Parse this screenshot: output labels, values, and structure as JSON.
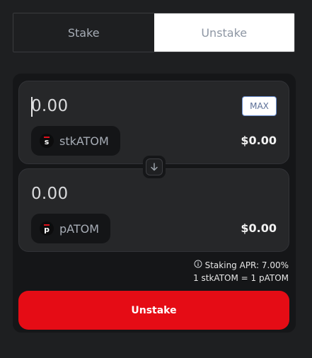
{
  "tabs": {
    "stake": "Stake",
    "unstake": "Unstake",
    "active": "Unstake"
  },
  "from": {
    "amount": "0.00",
    "max_label": "MAX",
    "token_symbol": "stkATOM",
    "token_icon_letter": "s",
    "usd_value": "$0.00"
  },
  "to": {
    "amount": "0.00",
    "token_symbol": "pATOM",
    "token_icon_letter": "p",
    "usd_value": "$0.00"
  },
  "info": {
    "apr_text": "Staking APR: 7.00%",
    "rate_text": "1 stkATOM = 1 pATOM"
  },
  "action": {
    "label": "Unstake"
  },
  "colors": {
    "accent": "#e50c15",
    "background": "#1e1f21",
    "card": "#262729"
  }
}
